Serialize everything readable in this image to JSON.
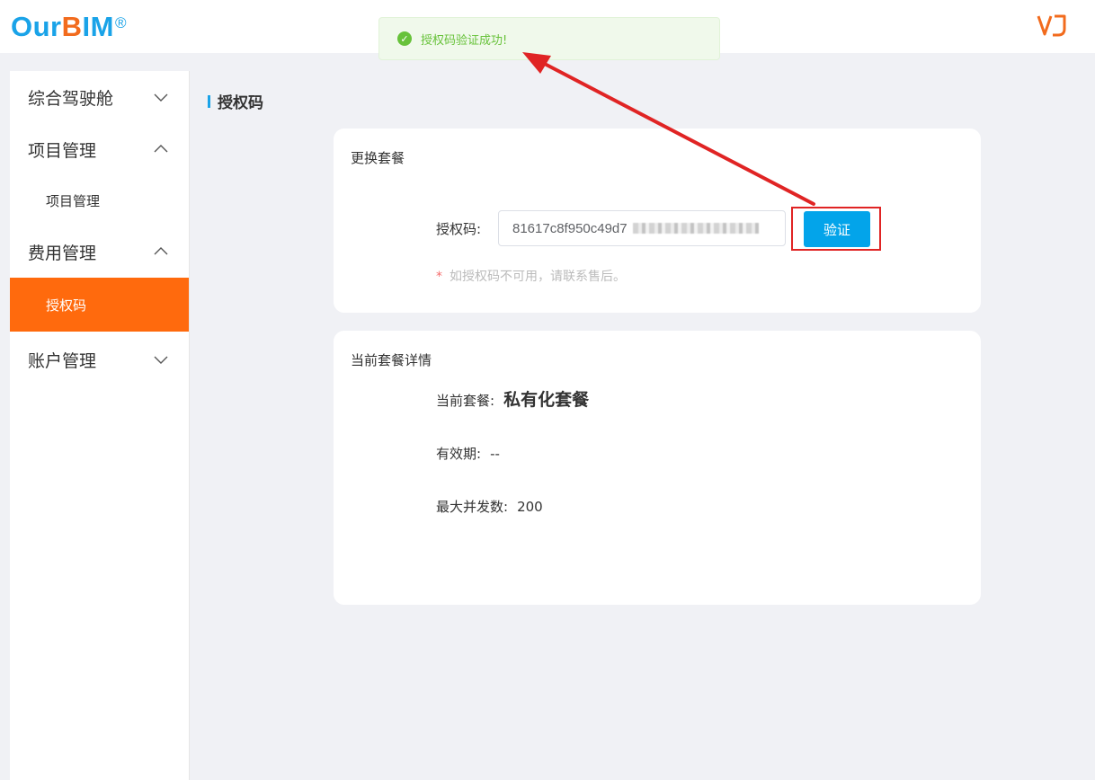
{
  "header": {
    "logo": {
      "part1": "Our",
      "part2": "B",
      "part3": "IM",
      "reg": "®"
    },
    "right_icon": "vj-logo-icon"
  },
  "toast": {
    "icon": "check-circle-icon",
    "message": "授权码验证成功!"
  },
  "sidebar": {
    "items": [
      {
        "label": "综合驾驶舱",
        "expanded": false
      },
      {
        "label": "项目管理",
        "expanded": true,
        "children": [
          {
            "label": "项目管理"
          }
        ]
      },
      {
        "label": "费用管理",
        "expanded": true,
        "children": [
          {
            "label": "授权码",
            "active": true
          }
        ]
      },
      {
        "label": "账户管理",
        "expanded": false
      }
    ]
  },
  "page": {
    "title": "授权码"
  },
  "change_plan": {
    "title": "更换套餐",
    "code_label": "授权码:",
    "code_value": "81617c8f950c49d7",
    "verify_label": "验证",
    "hint_star": "*",
    "hint_text": "如授权码不可用，请联系售后。"
  },
  "current_plan": {
    "title": "当前套餐详情",
    "plan_label": "当前套餐:",
    "plan_value": "私有化套餐",
    "validity_label": "有效期:",
    "validity_value": "--",
    "concurrency_label": "最大并发数:",
    "concurrency_value": "200"
  },
  "colors": {
    "accent": "#ff6a0d",
    "primary": "#03a4ea",
    "success": "#67c23a",
    "annotation": "#e02424"
  }
}
